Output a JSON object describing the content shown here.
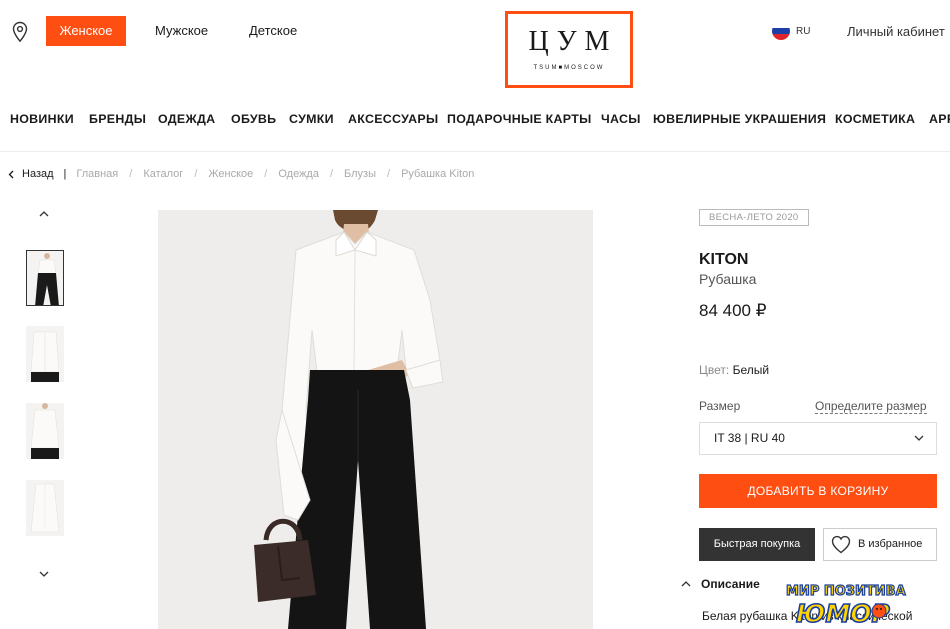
{
  "header": {
    "gender_tabs": [
      {
        "label": "Женское",
        "active": true
      },
      {
        "label": "Мужское",
        "active": false
      },
      {
        "label": "Детское",
        "active": false
      }
    ],
    "logo": {
      "main": "ЦУМ",
      "sub": "TSUM■MOSCOW"
    },
    "language": "RU",
    "account_label": "Личный кабинет",
    "accent_color": "#ff4e12"
  },
  "categories": [
    "НОВИНКИ",
    "БРЕНДЫ",
    "ОДЕЖДА",
    "ОБУВЬ",
    "СУМКИ",
    "АКСЕССУАРЫ",
    "ПОДАРОЧНЫЕ КАРТЫ",
    "ЧАСЫ",
    "ЮВЕЛИРНЫЕ УКРАШЕНИЯ",
    "КОСМЕТИКА",
    "APP"
  ],
  "breadcrumb": {
    "back_label": "Назад",
    "items": [
      "Главная",
      "Каталог",
      "Женское",
      "Одежда",
      "Блузы",
      "Рубашка Kiton"
    ]
  },
  "gallery": {
    "thumbnail_count": 4,
    "active_thumbnail": 0
  },
  "product": {
    "season": "ВЕСНА-ЛЕТО 2020",
    "brand": "KITON",
    "type": "Рубашка",
    "price": "84 400 ₽",
    "color_label": "Цвет:",
    "color_value": "Белый",
    "size_label": "Размер",
    "size_guide_link": "Определите размер",
    "selected_size": "IT 38 | RU 40",
    "add_to_cart": "ДОБАВИТЬ В КОРЗИНУ",
    "quick_buy": "Быстрая покупка",
    "favorite": "В избранное",
    "description_title": "Описание",
    "description_text": "Белая рубашка Kiton из классической"
  },
  "watermark": {
    "top": "МИР ПОЗИТИВА",
    "bottom": "ЮМОР"
  }
}
